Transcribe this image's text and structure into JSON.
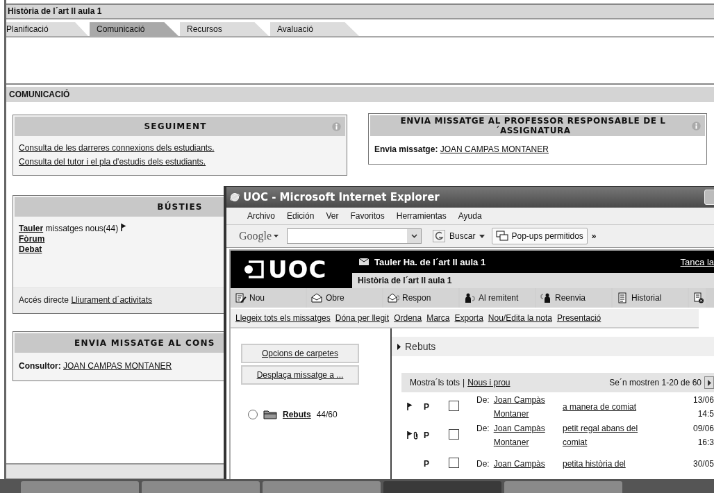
{
  "page": {
    "title": "Història de l´art II aula 1"
  },
  "tabs": [
    {
      "label": "Planificació",
      "selected": false
    },
    {
      "label": "Comunicació",
      "selected": true
    },
    {
      "label": "Recursos",
      "selected": false
    },
    {
      "label": "Avaluació",
      "selected": false
    }
  ],
  "section": {
    "title": "COMUNICACIÓ"
  },
  "seguiment": {
    "title": "SEGUIMENT",
    "links": [
      "Consulta de les darreres connexions dels estudiants.",
      "Consulta del tutor i el pla d'estudis dels estudiants."
    ]
  },
  "professor": {
    "title": "ENVIA MISSATGE AL PROFESSOR RESPONSABLE DE L´ASSIGNATURA",
    "label": "Envia missatge:",
    "link": "JOAN CAMPAS MONTANER"
  },
  "busties": {
    "title": "BÚSTIES",
    "items": [
      {
        "link": "Tauler",
        "note": "missatges nous(44)",
        "flagged": true
      },
      {
        "link": "Fòrum",
        "flagged": false
      },
      {
        "link": "Debat",
        "flagged": false
      }
    ],
    "footer_label": "Accés directe",
    "footer_link": "Lliurament d´activitats"
  },
  "consultor": {
    "title": "ENVIA MISSATGE AL CONS",
    "label": "Consultor:",
    "link": "JOAN CAMPAS MONTANER"
  },
  "browser": {
    "title": "UOC - Microsoft Internet Explorer",
    "menu": [
      "Archivo",
      "Edición",
      "Ver",
      "Favoritos",
      "Herramientas",
      "Ayuda"
    ],
    "google_toolbar": {
      "brand": "Google",
      "search_button": "Buscar",
      "popups": "Pop-ups permitidos",
      "more": "»"
    },
    "header": {
      "logo": "UOC",
      "board": "Tauler Ha. de l´art II aula 1",
      "subject": "Història de l´art II aula 1",
      "close_link": "Tanca la"
    },
    "toolbar": [
      {
        "label": "Nou",
        "kind": "new"
      },
      {
        "label": "Obre",
        "kind": "open"
      },
      {
        "label": "Respon",
        "kind": "reply"
      },
      {
        "label": "Al remitent",
        "kind": "sender"
      },
      {
        "label": "Reenvia",
        "kind": "forward"
      },
      {
        "label": "Historial",
        "kind": "history"
      },
      {
        "kind": "delete"
      }
    ],
    "actions": [
      "Llegeix tots els missatges",
      "Dóna per llegit",
      "Ordena",
      "Marca",
      "Exporta",
      "Nou/Edita la nota",
      "Presentació"
    ],
    "folder_options": [
      "Opcions de carpetes",
      "Desplaça missatge a ..."
    ],
    "folders": [
      {
        "name": "Rebuts",
        "count": "44/60",
        "selected": false
      }
    ],
    "list": {
      "heading": "Rebuts",
      "show_all": "Mostra´ls tots",
      "separator": "|",
      "new_only": "Nous i prou",
      "range": "Se´n mostren 1-20 de 60"
    },
    "messages": [
      {
        "flagged": true,
        "attachment": false,
        "priority": "P",
        "checked": false,
        "from_label": "De:",
        "sender": "Joan Campàs Montaner",
        "subject": "a manera de comiat",
        "date": "13/06",
        "time": "14:5"
      },
      {
        "flagged": true,
        "attachment": true,
        "priority": "P",
        "checked": false,
        "from_label": "De:",
        "sender": "Joan Campàs Montaner",
        "subject": "petit regal abans del comiat",
        "date": "09/06",
        "time": "16:3"
      },
      {
        "flagged": false,
        "attachment": false,
        "priority": "P",
        "checked": false,
        "from_label": "De:",
        "sender": "Joan Campàs",
        "subject": "petita història del",
        "date": "30/05"
      }
    ]
  }
}
